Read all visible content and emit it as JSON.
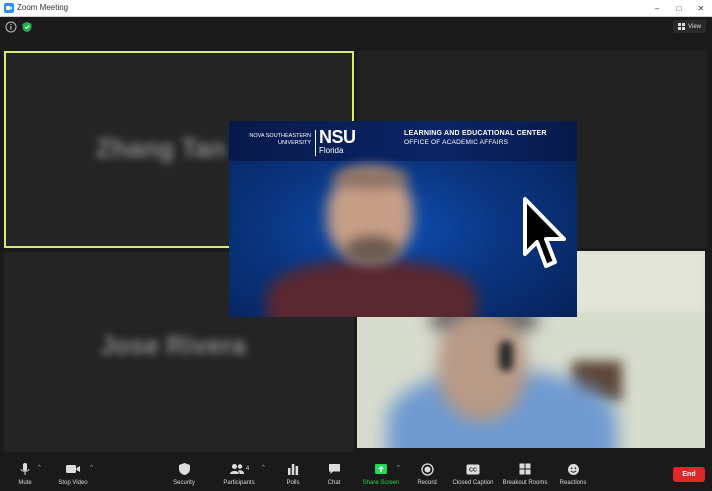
{
  "window": {
    "title": "Zoom Meeting"
  },
  "topbar": {
    "view_label": "View"
  },
  "participants": [
    {
      "name": "Zhang Tan"
    },
    {
      "name": "Jose Rivera"
    }
  ],
  "shared_content": {
    "org_small": [
      "NOVA SOUTHEASTERN",
      "UNIVERSITY"
    ],
    "org_big": "NSU",
    "org_sub": "Florida",
    "center_title": "LEARNING AND EDUCATIONAL CENTER",
    "center_subtitle": "OFFICE OF ACADEMIC AFFAIRS"
  },
  "toolbar": {
    "mute": "Mute",
    "stop_video": "Stop Video",
    "security": "Security",
    "participants": "Participants",
    "participants_count": "4",
    "polls": "Polls",
    "chat": "Chat",
    "share_screen": "Share Screen",
    "record": "Record",
    "closed_caption": "Closed Caption",
    "breakout_rooms": "Breakout Rooms",
    "reactions": "Reactions",
    "end": "End"
  },
  "colors": {
    "active_speaker_border": "#d6ec6f",
    "share_green": "#23d959",
    "end_red": "#e02828",
    "zoom_blue": "#2D8CFF"
  }
}
